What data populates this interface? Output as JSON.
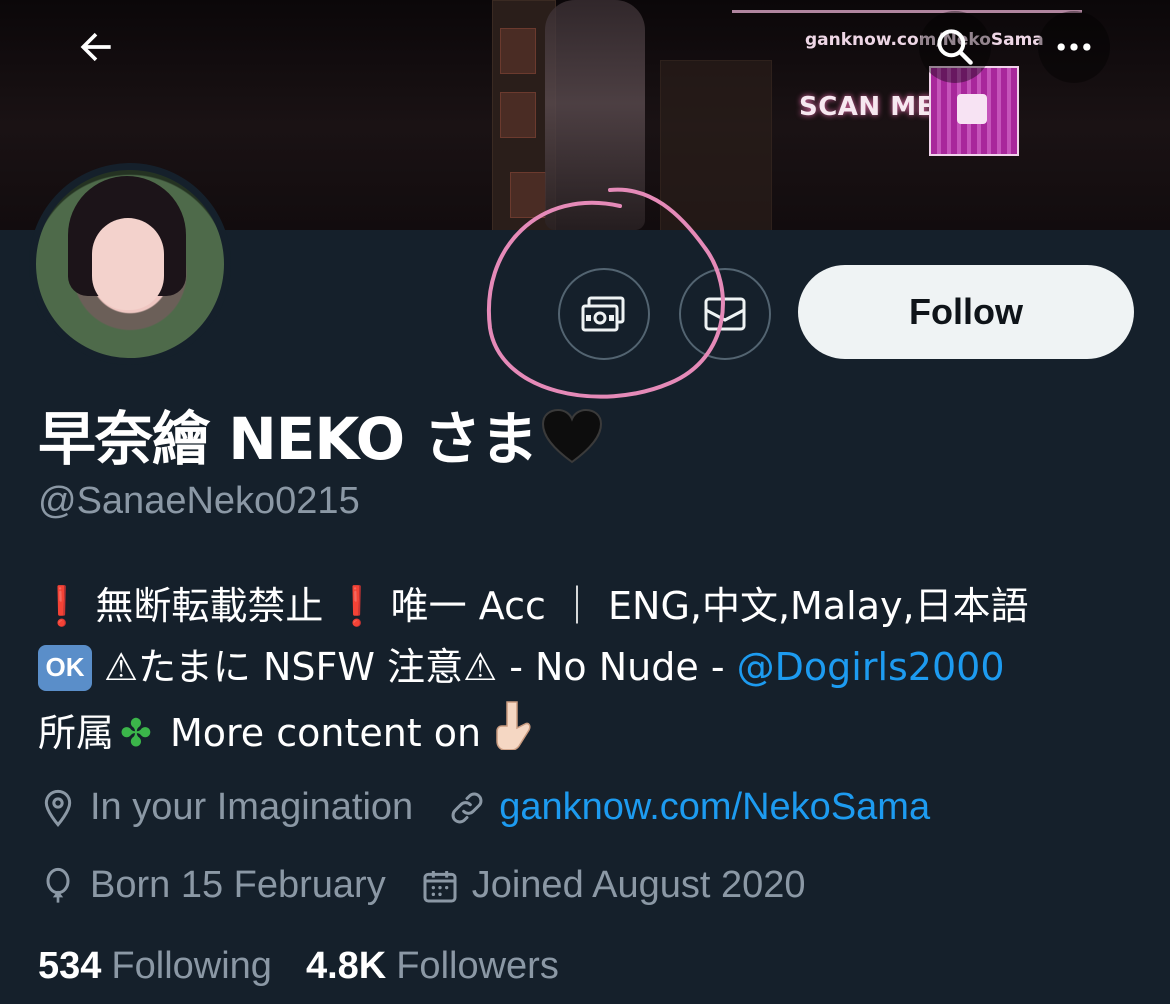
{
  "header": {
    "banner_url_text": "ganknow.com/NekoSama",
    "banner_scan_text": "SCAN ME"
  },
  "profile": {
    "display_name": "早奈繪 NEKO さま",
    "handle": "@SanaeNeko0215",
    "follow_label": "Follow",
    "bio": {
      "line1": "無断転載禁止",
      "line1b": "唯一 Acc ｜ ENG,中文,Malay,日本語",
      "ok_label": "OK",
      "line2": "⚠たまに NSFW 注意⚠ - No Nude - ",
      "mention": "@Dogirls2000",
      "line3a": "所属",
      "line3b": " More content on "
    },
    "location": "In your Imagination",
    "website": "ganknow.com/NekoSama",
    "birthday": "Born 15 February",
    "joined": "Joined August 2020",
    "following_count": "534",
    "following_label": "Following",
    "followers_count": "4.8K",
    "followers_label": "Followers"
  },
  "icons": {
    "back": "back-arrow-icon",
    "search": "search-icon",
    "more": "more-icon",
    "tip": "money-icon",
    "message": "envelope-icon",
    "location": "location-pin-icon",
    "link": "link-icon",
    "birthday": "balloon-icon",
    "calendar": "calendar-icon"
  },
  "colors": {
    "background": "#15202b",
    "link": "#1d9bf0",
    "secondary_text": "#8b98a5",
    "annotation": "#e58ab8"
  }
}
